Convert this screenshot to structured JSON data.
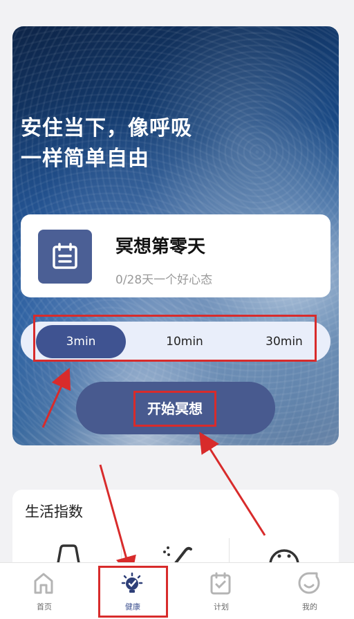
{
  "hero": {
    "title_line1": "安住当下，像呼吸",
    "title_line2": "一样简单自由"
  },
  "status": {
    "title": "冥想第零天",
    "subtitle": "0/28天一个好心态",
    "icon": "calendar-icon"
  },
  "durations": {
    "options": [
      "3min",
      "10min",
      "30min"
    ],
    "selected": "3min"
  },
  "start_button": {
    "label": "开始冥想"
  },
  "life_index": {
    "title": "生活指数",
    "icons": [
      "car-icon",
      "sport-icon",
      "face-icon"
    ]
  },
  "tabbar": {
    "items": [
      {
        "label": "首页",
        "icon": "home-icon"
      },
      {
        "label": "健康",
        "icon": "health-bulb-icon"
      },
      {
        "label": "计划",
        "icon": "plan-calendar-icon"
      },
      {
        "label": "我的",
        "icon": "profile-icon"
      }
    ],
    "active": "健康"
  },
  "colors": {
    "accent": "#3f5391",
    "annotation": "#d82b2b",
    "status_icon_bg": "#4b5f95",
    "inactive_icon": "#b4b4b4"
  }
}
